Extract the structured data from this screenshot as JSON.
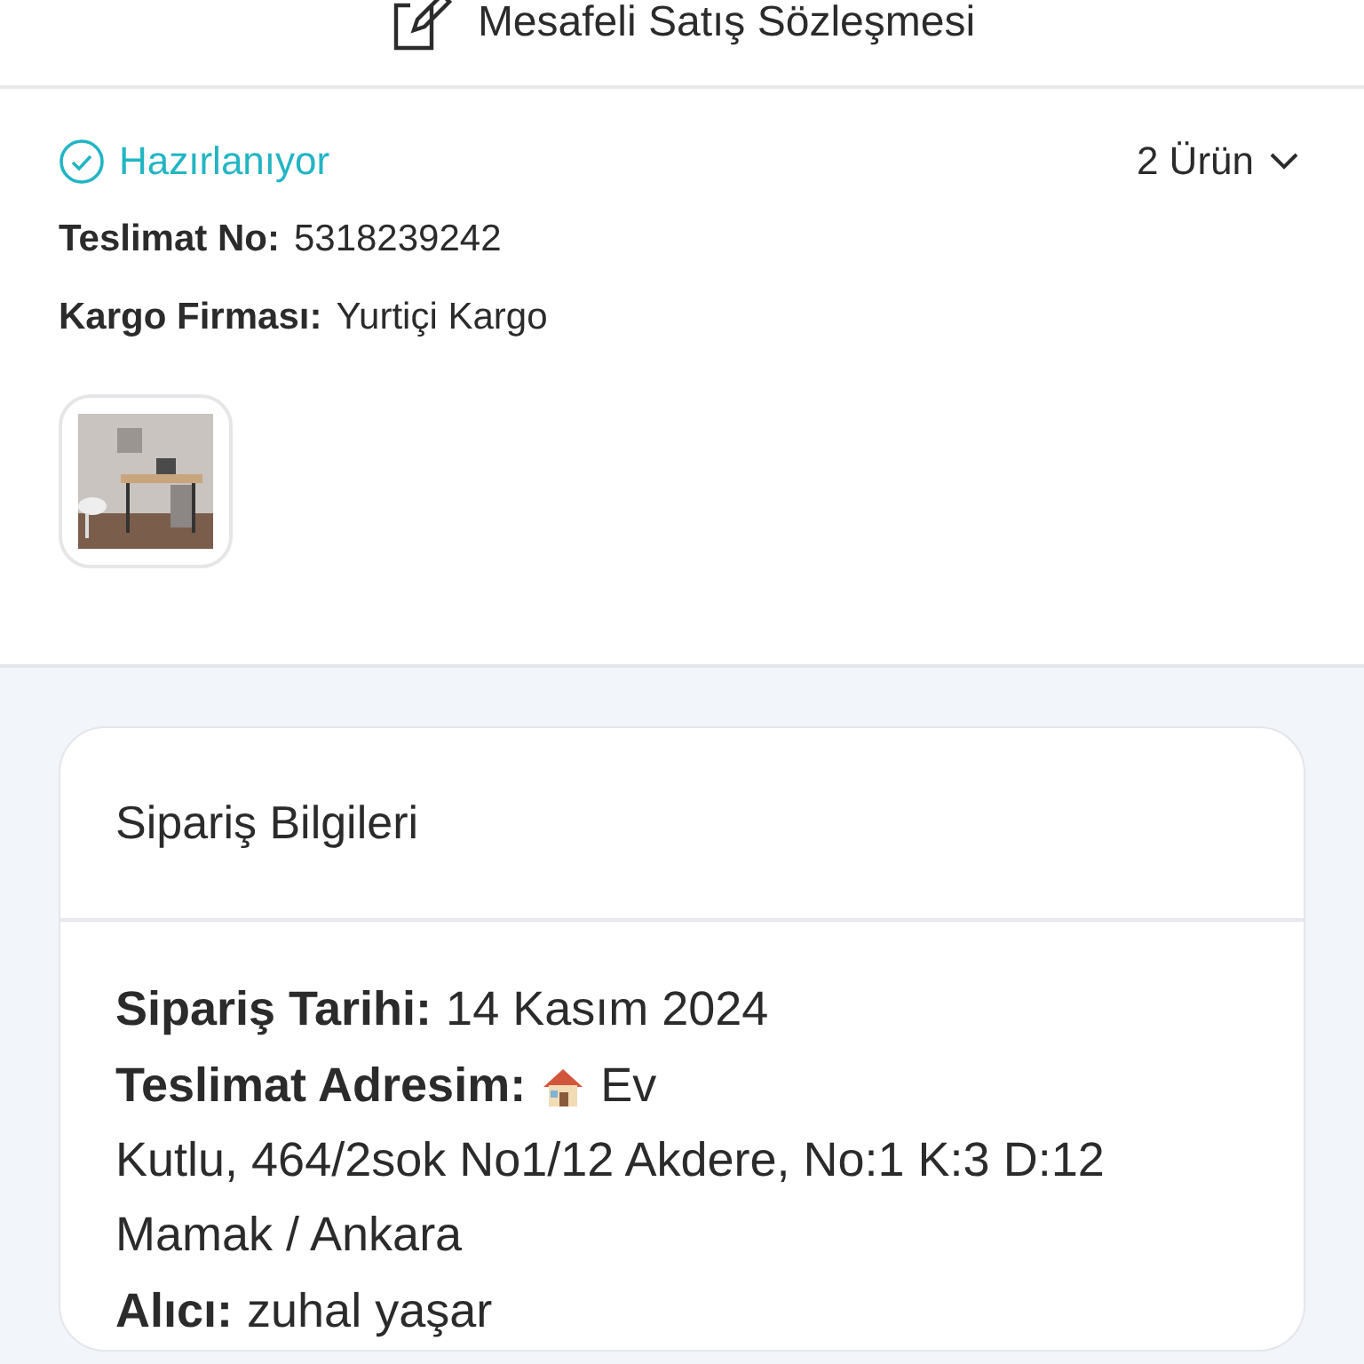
{
  "contract_link": {
    "label": "Mesafeli Satış Sözleşmesi"
  },
  "shipment": {
    "status": "Hazırlanıyor",
    "item_count": "2 Ürün",
    "expanded": false,
    "fields": [
      {
        "label": "Teslimat No:",
        "value": "5318239242"
      },
      {
        "label": "Kargo Firması:",
        "value": "Yurtiçi Kargo"
      }
    ]
  },
  "order_info": {
    "title": "Sipariş Bilgileri",
    "date": {
      "label": "Sipariş Tarihi:",
      "value": "14 Kasım 2024"
    },
    "address": {
      "label": "Teslimat Adresim:",
      "value": "Ev",
      "lines": [
        "Kutlu, 464/2sok No1/12 Akdere, No:1 K:3 D:12",
        "Mamak / Ankara"
      ]
    },
    "recipient": {
      "label": "Alıcı:",
      "value": "zuhal yaşar"
    }
  }
}
